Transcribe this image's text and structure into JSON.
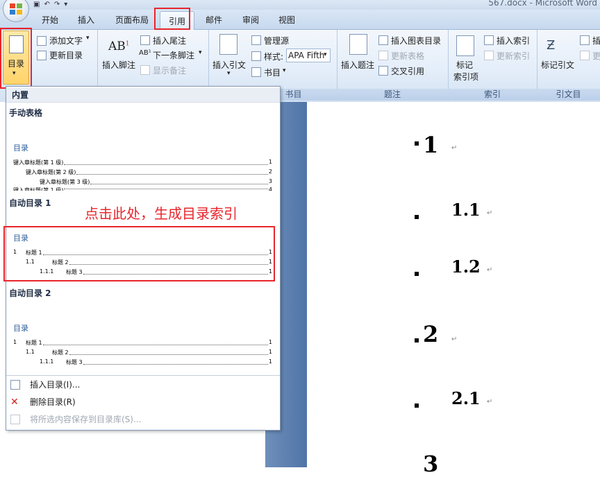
{
  "window": {
    "title": "567.docx - Microsoft Word"
  },
  "tabs": [
    "开始",
    "插入",
    "页面布局",
    "引用",
    "邮件",
    "审阅",
    "视图"
  ],
  "active_tab": "引用",
  "ribbon": {
    "toc_group": {
      "toc_button": "目录",
      "add_text": "添加文字",
      "update_toc": "更新目录"
    },
    "footnotes_group": {
      "insert_footnote": "插入脚注",
      "insert_endnote": "插入尾注",
      "next_footnote": "下一条脚注",
      "show_notes": "显示备注"
    },
    "citations_group": {
      "insert_citation": "插入引文",
      "manage_sources": "管理源",
      "style_label": "样式:",
      "style_value": "APA Fifth",
      "bibliography": "书目",
      "label": "书目"
    },
    "captions_group": {
      "insert_caption": "插入题注",
      "insert_table_of_figures": "插入图表目录",
      "update_table": "更新表格",
      "cross_reference": "交叉引用",
      "label": "题注"
    },
    "index_group": {
      "mark_entry": "标记\n索引项",
      "mark_entry_line1": "标记",
      "mark_entry_line2": "索引项",
      "insert_index": "插入索引",
      "update_index": "更新索引",
      "label": "索引"
    },
    "toa_group": {
      "mark_citation": "标记引文",
      "insert_toa_partial": "插",
      "update_toa_partial": "更",
      "label": "引文目"
    }
  },
  "dropdown": {
    "header": "内置",
    "manual": {
      "label": "手动表格",
      "preview_title": "目录",
      "lines": [
        {
          "text": "键入章标题(第 1 级)",
          "page": "1"
        },
        {
          "text": "键入章标题(第 2 级)",
          "page": "2"
        },
        {
          "text": "键入章标题(第 3 级)",
          "page": "3"
        },
        {
          "text": "键入章标题(第 1 级)",
          "page": "4"
        }
      ]
    },
    "auto1": {
      "label": "自动目录 1",
      "preview_title": "目录",
      "lines": [
        {
          "num": "1",
          "text": "标题 1",
          "page": "1"
        },
        {
          "num": "1.1",
          "text": "标题 2",
          "page": "1"
        },
        {
          "num": "1.1.1",
          "text": "标题 3",
          "page": "1"
        }
      ]
    },
    "auto2": {
      "label": "自动目录 2",
      "preview_title": "目录",
      "lines": [
        {
          "num": "1",
          "text": "标题 1",
          "page": "1"
        },
        {
          "num": "1.1",
          "text": "标题 2",
          "page": "1"
        },
        {
          "num": "1.1.1",
          "text": "标题 3",
          "page": "1"
        }
      ]
    },
    "commands": {
      "insert_toc": "插入目录(I)...",
      "remove_toc": "删除目录(R)",
      "save_selection": "将所选内容保存到目录库(S)..."
    }
  },
  "annotation": {
    "callout": "点击此处，生成目录索引"
  },
  "document": {
    "headings": [
      "1",
      "1.1",
      "1.2",
      "2",
      "2.1",
      "3"
    ],
    "return_mark": "↵"
  },
  "colors": {
    "highlight": "#e8252b",
    "ribbon_bg": "#dfe9f5",
    "doc_side": "#5a7db0"
  }
}
